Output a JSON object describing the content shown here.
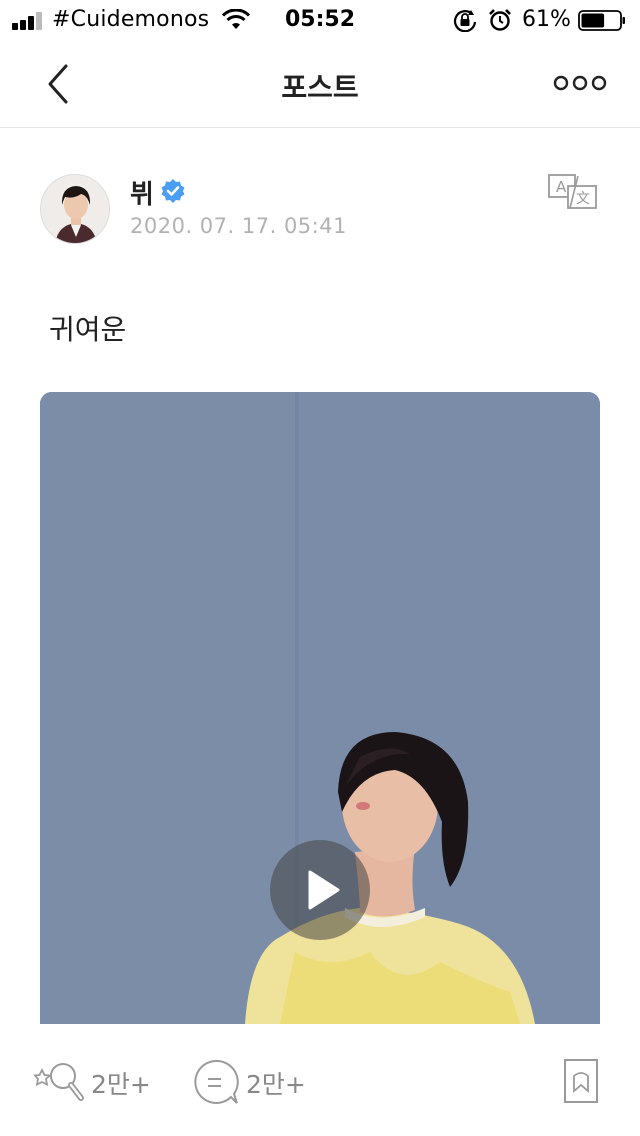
{
  "status_bar": {
    "carrier": "#Cuidemonos",
    "time": "05:52",
    "battery_percent": "61%",
    "battery_level": 0.61,
    "signal_bars": 3
  },
  "nav": {
    "title": "포스트",
    "back_icon": "chevron-left-icon",
    "more_icon": "more-horizontal-icon"
  },
  "post": {
    "author": "뷔",
    "verified_icon": "verified-badge-icon",
    "timestamp": "2020. 07. 17. 05:41",
    "translate_icon": "translate-icon",
    "text": "귀여운",
    "media": {
      "type": "video",
      "play_icon": "play-icon"
    }
  },
  "actions": {
    "like_count": "2만+",
    "comment_count": "2만+",
    "like_icon": "cheer-wand-icon",
    "comment_icon": "comment-bubble-icon",
    "bookmark_icon": "bookmark-icon"
  },
  "colors": {
    "accent_verified": "#4a9ff5",
    "muted_text": "#b2b2b2",
    "icon_gray": "#9a9a9a"
  }
}
